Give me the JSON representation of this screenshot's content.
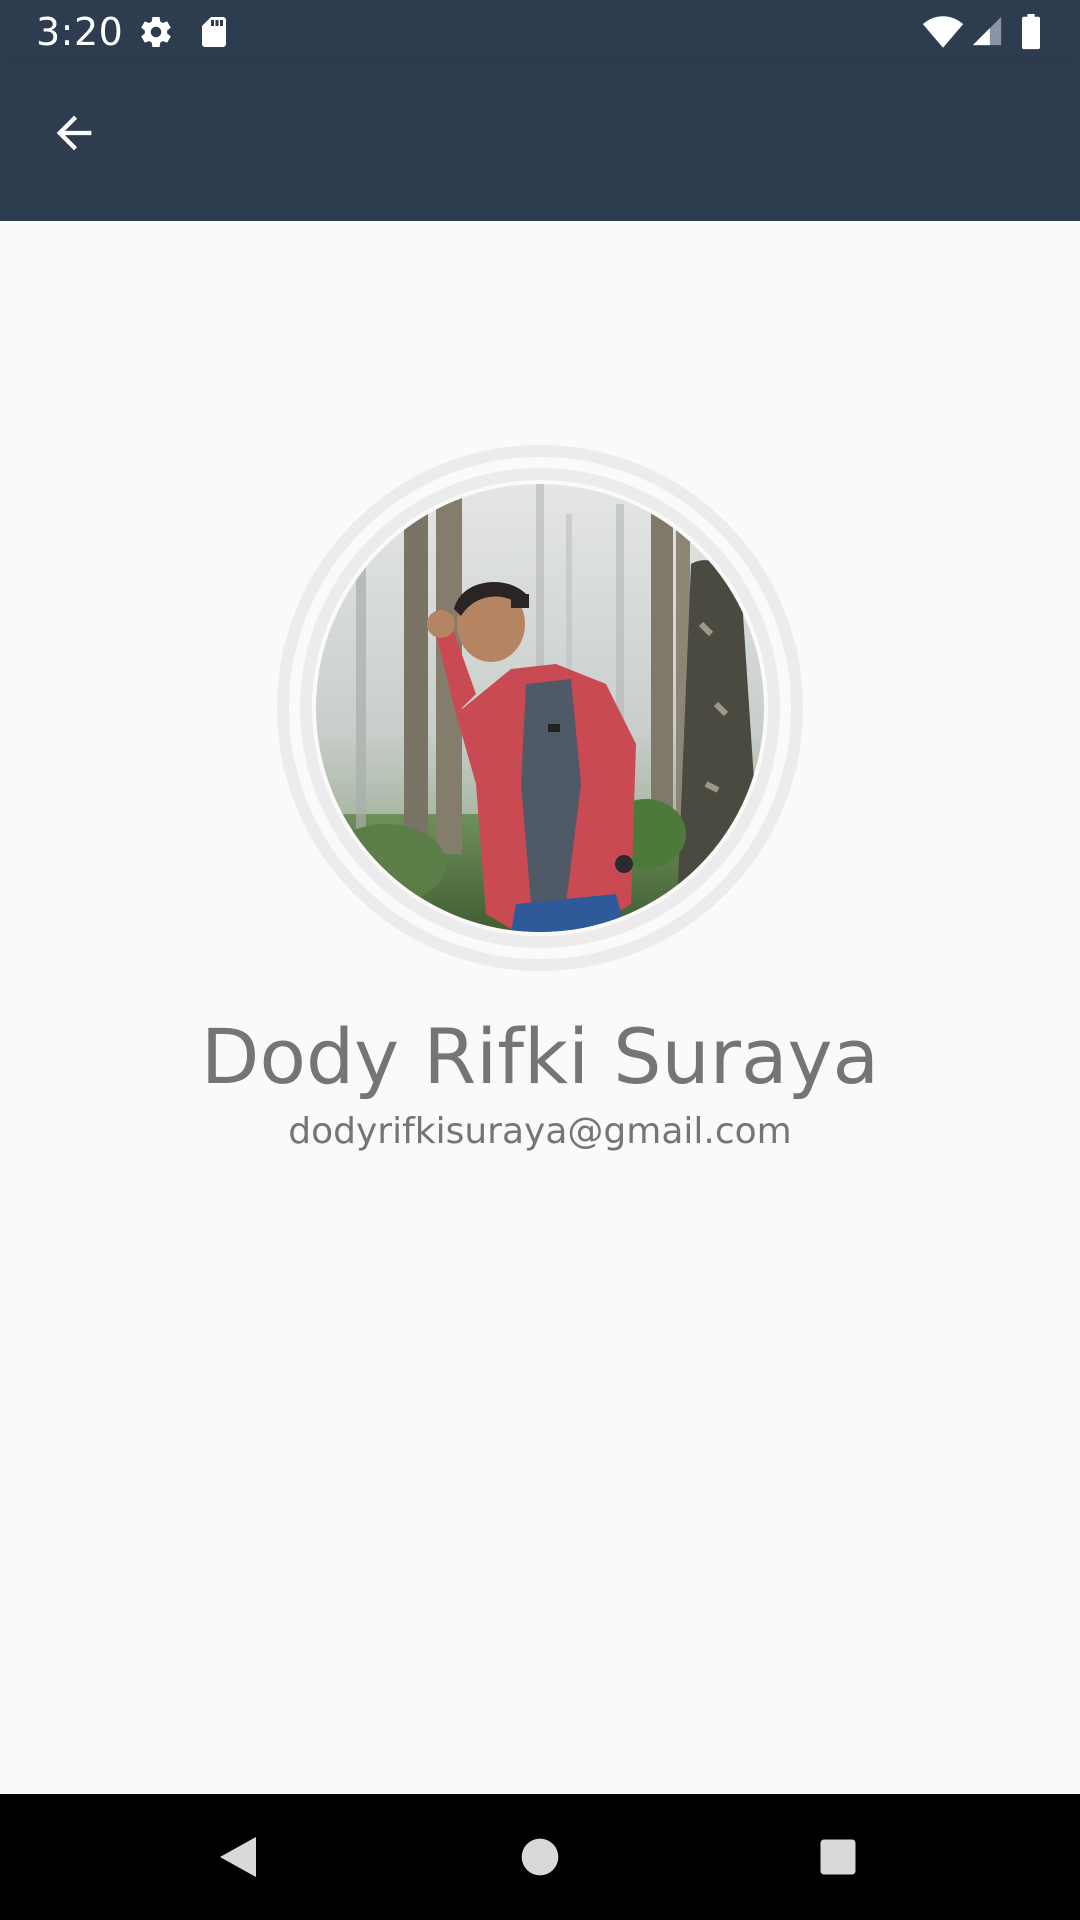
{
  "status_bar": {
    "time": "3:20",
    "left_icons": [
      "gear-icon",
      "sd-card-icon"
    ],
    "right_icons": [
      "wifi-icon",
      "cell-signal-icon",
      "battery-icon"
    ]
  },
  "app_bar": {
    "back_icon": "arrow-left-icon",
    "color": "#2e3c50"
  },
  "profile": {
    "name": "Dody Rifki Suraya",
    "email": "dodyrifkisuraya@gmail.com",
    "photo": "profile-photo"
  },
  "nav_bar": {
    "buttons": [
      "back-triangle-icon",
      "home-circle-icon",
      "recents-square-icon"
    ]
  },
  "colors": {
    "primary": "#2e3c50",
    "background": "#fafafa",
    "text_secondary": "#757575",
    "ring": "#ececec"
  }
}
